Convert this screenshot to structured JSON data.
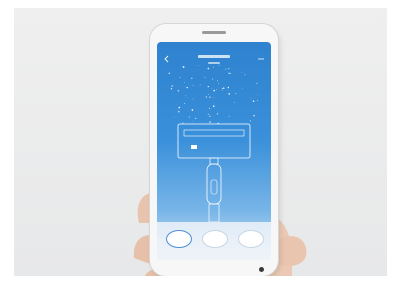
{
  "image": {
    "scene": "hand-holding-smartphone",
    "colors": {
      "background": "#ebeced",
      "screen_top": "#2e82cf",
      "screen_bottom": "#dbe8f4",
      "skin": "#e9c9b4",
      "phone_body": "#f7f7f7"
    }
  },
  "app": {
    "back_icon": "back-arrow-icon",
    "menu_icon": "more-icon",
    "device_illustration": "handheld-vacuum-icon",
    "buttons": [
      {
        "label": "",
        "selected": true
      },
      {
        "label": "",
        "selected": false
      },
      {
        "label": "",
        "selected": false
      }
    ]
  }
}
